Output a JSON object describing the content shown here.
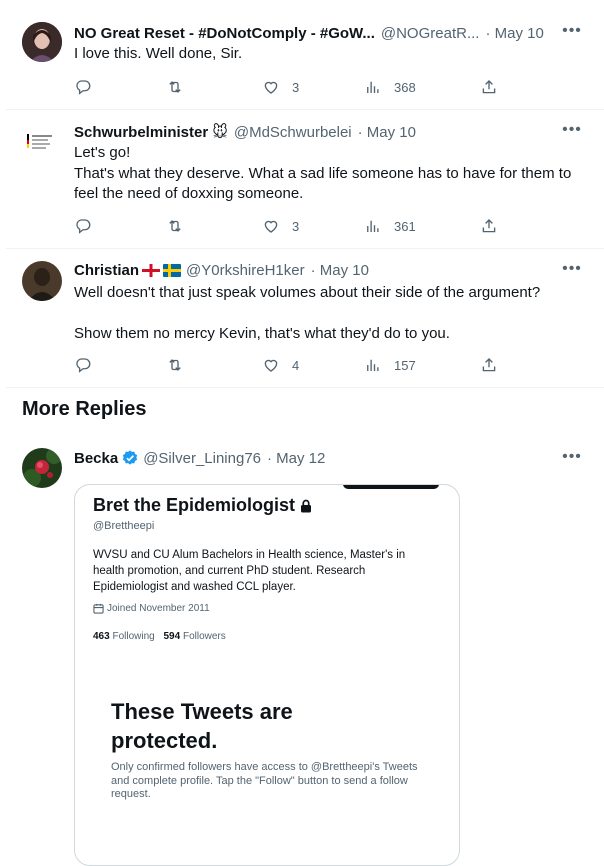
{
  "tweets": [
    {
      "name": "NO Great Reset - #DoNotComply - #GoW...",
      "handle": "@NOGreatR...",
      "date": "· May 10",
      "text": [
        "I love this.  Well done, Sir."
      ],
      "likes": "3",
      "views": "368"
    },
    {
      "name": "Schwurbelminister",
      "name_emoji": "🐭",
      "handle": "@MdSchwurbelei",
      "date": "· May 10",
      "text": [
        "Let's go!",
        "That's what they deserve. What a sad life someone has to have for them to feel the need of doxxing someone."
      ],
      "likes": "3",
      "views": "361"
    },
    {
      "name": "Christian",
      "handle": "@Y0rkshireH1ker",
      "date": "· May 10",
      "text": [
        "Well doesn't that just speak volumes about their side of the argument?",
        "",
        "Show them no mercy Kevin, that's what they'd do to you."
      ],
      "likes": "4",
      "views": "157"
    }
  ],
  "more_replies": {
    "title": "More Replies",
    "tweet": {
      "name": "Becka",
      "handle": "@Silver_Lining76",
      "date": "· May 12"
    }
  },
  "embedded_profile": {
    "name": "Bret the Epidemiologist",
    "handle": "@Brettheepi",
    "bio": "WVSU and CU Alum Bachelors in Health science, Master's in health promotion, and current PhD student. Research Epidemiologist and washed CCL player.",
    "joined": "Joined November 2011",
    "following_count": "463",
    "following_label": "Following",
    "followers_count": "594",
    "followers_label": "Followers",
    "protected_title": "These Tweets are protected.",
    "protected_text": "Only confirmed followers have access to @Brettheepi's Tweets and complete profile. Tap the \"Follow\" button to send a follow request."
  },
  "more_glyph": "•••",
  "colors": {
    "text": "#0f1419",
    "muted": "#536471",
    "border": "#eff3f4",
    "verified": "#1d9bf0"
  },
  "icons": [
    "reply-icon",
    "retweet-icon",
    "like-icon",
    "views-icon",
    "share-icon",
    "more-icon",
    "verified-badge-icon",
    "lock-icon",
    "calendar-icon"
  ]
}
